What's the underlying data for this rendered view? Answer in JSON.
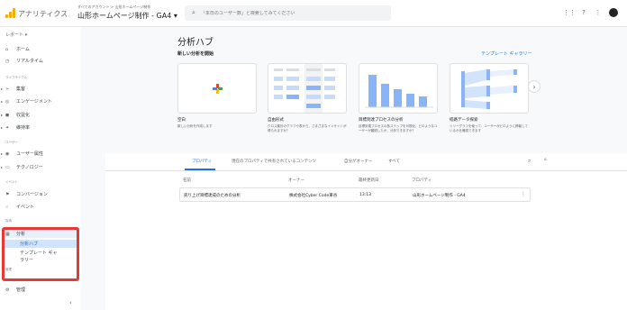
{
  "app": {
    "brand": "アナリティクス",
    "account_path": "すべてのアカウント > 山形ホームページ制作",
    "property": "山形ホームページ制作 - GA4",
    "search_placeholder": "「本日のユーザー数」と検索してみてください"
  },
  "sidebar": {
    "report_header": "レポート ▾",
    "sections": {
      "lifecycle": "ライフサイクル",
      "user": "ユーザー",
      "event": "イベント",
      "explore": "探索",
      "manage": "管理"
    },
    "items": [
      {
        "label": "ホーム",
        "icon": "home-icon"
      },
      {
        "label": "リアルタイム",
        "icon": "clock-icon"
      },
      {
        "label": "集客",
        "icon": "acquisition-icon"
      },
      {
        "label": "エンゲージメント",
        "icon": "engagement-icon"
      },
      {
        "label": "収益化",
        "icon": "monetization-icon"
      },
      {
        "label": "維持率",
        "icon": "retention-icon"
      },
      {
        "label": "ユーザー属性",
        "icon": "globe-icon"
      },
      {
        "label": "テクノロジー",
        "icon": "device-icon"
      },
      {
        "label": "コンバージョン",
        "icon": "flag-icon"
      },
      {
        "label": "イベント",
        "icon": "touch-icon"
      },
      {
        "label": "分析",
        "icon": "analysis-icon"
      },
      {
        "label": "分析ハブ"
      },
      {
        "label": "テンプレート ギャ"
      },
      {
        "label": "ラリー"
      },
      {
        "label": "管理",
        "icon": "gear-icon"
      }
    ]
  },
  "main": {
    "title": "分析ハブ",
    "new_analysis": "新しい分析を開始",
    "gallery_link": "テンプレート ギャラリー",
    "cards": [
      {
        "title": "空白",
        "desc": "新しい分析を作成します"
      },
      {
        "title": "自由形式",
        "desc": "クロス集計のグラフや表から、さまざまなインサイトが得られますか？"
      },
      {
        "title": "目標到達プロセスの分析",
        "desc": "目標到達プロセスの各ステップを可視化。どのようなユーザーが離脱したか、分析できますか？"
      },
      {
        "title": "経路データ探索",
        "desc": "ツリーグラフを使って、ユーザーがどのように移動しているかを確認できます"
      }
    ],
    "tabs": [
      "プロパティ",
      "現在のプロパティで共有されているコンテンツ",
      "自分がオーナー",
      "すべて"
    ],
    "columns": [
      "名前",
      "オーナー",
      "最終更新日",
      "プロパティ"
    ],
    "rows": [
      {
        "name": "売り上げ目標達成のための分析",
        "owner": "株式会社Cyber Code東谷",
        "updated": "13:13",
        "property": "山形ホームページ制作 - GA4"
      }
    ]
  }
}
